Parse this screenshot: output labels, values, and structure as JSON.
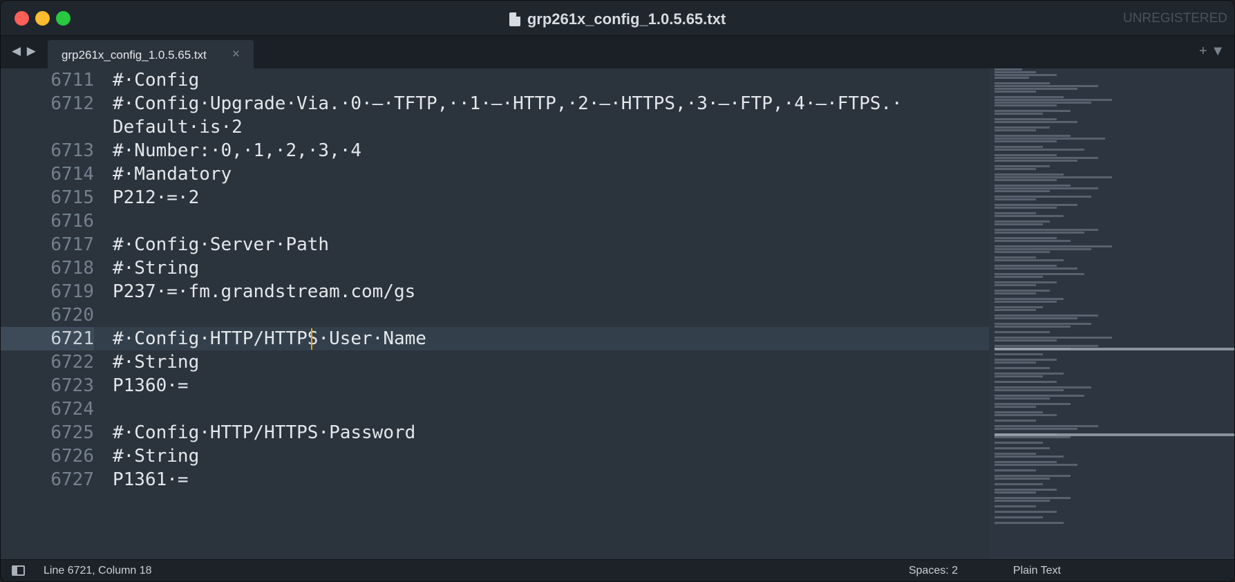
{
  "window": {
    "title": "grp261x_config_1.0.5.65.txt",
    "unregistered_label": "UNREGISTERED"
  },
  "tabbar": {
    "nav_arrows": "◀ ▶",
    "tab_label": "grp261x_config_1.0.5.65.txt",
    "tab_close": "×",
    "actions": "+ ▼"
  },
  "editor": {
    "lines": [
      {
        "num": "6711",
        "text": "#·Config"
      },
      {
        "num": "6712",
        "text": "#·Config·Upgrade·Via.·0·–·TFTP,··1·–·HTTP,·2·–·HTTPS,·3·–·FTP,·4·–·FTPS.·"
      },
      {
        "num": "",
        "text": "Default·is·2"
      },
      {
        "num": "6713",
        "text": "#·Number:·0,·1,·2,·3,·4"
      },
      {
        "num": "6714",
        "text": "#·Mandatory"
      },
      {
        "num": "6715",
        "text": "P212·=·2"
      },
      {
        "num": "6716",
        "text": ""
      },
      {
        "num": "6717",
        "text": "#·Config·Server·Path"
      },
      {
        "num": "6718",
        "text": "#·String"
      },
      {
        "num": "6719",
        "text": "P237·=·fm.grandstream.com/gs"
      },
      {
        "num": "6720",
        "text": ""
      },
      {
        "num": "6721",
        "text": "#·Config·HTTP/HTTPS·User·Name"
      },
      {
        "num": "6722",
        "text": "#·String"
      },
      {
        "num": "6723",
        "text": "P1360·="
      },
      {
        "num": "6724",
        "text": ""
      },
      {
        "num": "6725",
        "text": "#·Config·HTTP/HTTPS·Password"
      },
      {
        "num": "6726",
        "text": "#·String"
      },
      {
        "num": "6727",
        "text": "P1361·="
      }
    ],
    "active_line": "6721"
  },
  "statusbar": {
    "position": "Line 6721, Column 18",
    "spaces": "Spaces: 2",
    "syntax": "Plain Text"
  },
  "colors": {
    "editor_bg": "#2b333d",
    "caret": "#f0a500",
    "active_line": "#33404c"
  }
}
